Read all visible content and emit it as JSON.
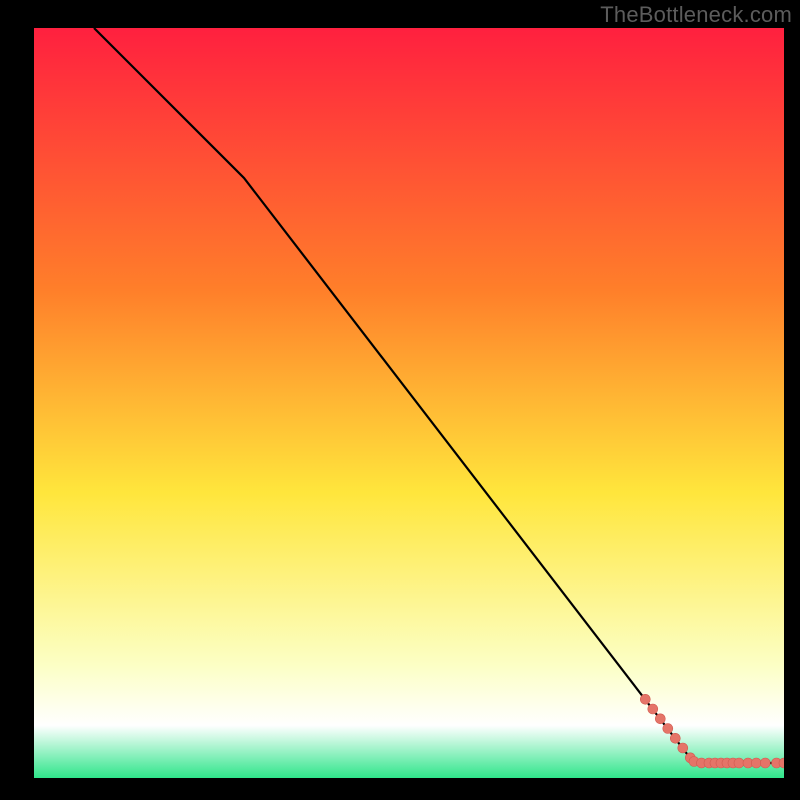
{
  "watermark": "TheBottleneck.com",
  "colors": {
    "frame": "#000000",
    "line": "#000000",
    "marker_fill": "#e57468",
    "marker_stroke": "#d25a50",
    "grad_top": "#ff203f",
    "grad_orange": "#ff7f2a",
    "grad_yellow": "#ffe63c",
    "grad_pale": "#fcffc5",
    "grad_white": "#ffffff",
    "grad_green": "#2fe58a"
  },
  "chart_data": {
    "type": "line",
    "title": "",
    "xlabel": "",
    "ylabel": "",
    "xlim": [
      0,
      100
    ],
    "ylim": [
      0,
      100
    ],
    "series": [
      {
        "name": "curve",
        "x": [
          8,
          28,
          88,
          100
        ],
        "y": [
          100,
          80,
          2,
          2
        ]
      }
    ],
    "markers": {
      "name": "dense-tail",
      "points": [
        {
          "x": 81.5,
          "y": 10.5
        },
        {
          "x": 82.5,
          "y": 9.2
        },
        {
          "x": 83.5,
          "y": 7.9
        },
        {
          "x": 84.5,
          "y": 6.6
        },
        {
          "x": 85.5,
          "y": 5.3
        },
        {
          "x": 86.5,
          "y": 4.0
        },
        {
          "x": 87.5,
          "y": 2.7
        },
        {
          "x": 88.0,
          "y": 2.2
        },
        {
          "x": 89.0,
          "y": 2.0
        },
        {
          "x": 90.0,
          "y": 2.0
        },
        {
          "x": 90.8,
          "y": 2.0
        },
        {
          "x": 91.6,
          "y": 2.0
        },
        {
          "x": 92.4,
          "y": 2.0
        },
        {
          "x": 93.2,
          "y": 2.0
        },
        {
          "x": 94.0,
          "y": 2.0
        },
        {
          "x": 95.2,
          "y": 2.0
        },
        {
          "x": 96.3,
          "y": 2.0
        },
        {
          "x": 97.5,
          "y": 2.0
        },
        {
          "x": 99.0,
          "y": 2.0
        },
        {
          "x": 100.0,
          "y": 2.0
        }
      ],
      "r": 5
    }
  }
}
